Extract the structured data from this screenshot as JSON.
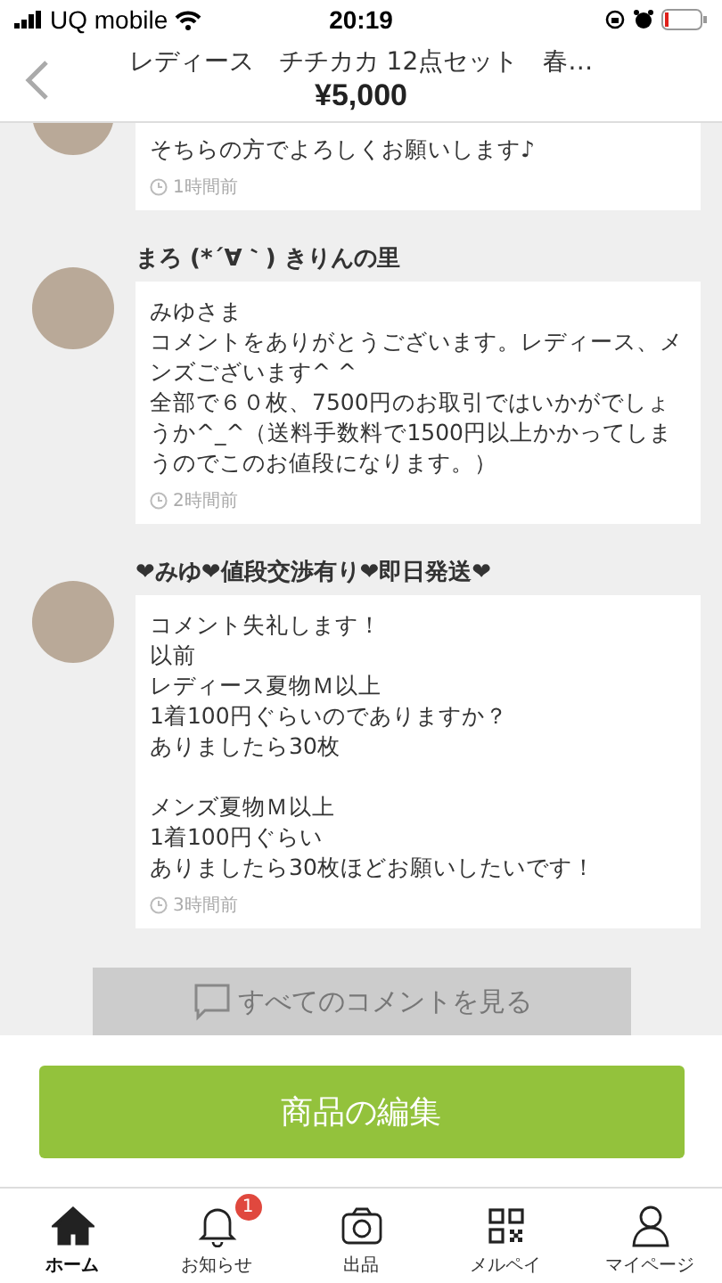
{
  "status_bar": {
    "carrier": "UQ mobile",
    "time": "20:19"
  },
  "header": {
    "title": "レディース　チチカカ 12点セット　春…",
    "price": "¥5,000"
  },
  "comments": [
    {
      "paragraphs": [
        [
          "そちらの方でよろしくお願いします♪"
        ]
      ],
      "time": "1時間前"
    },
    {
      "name": "まろ (*´∀｀) きりんの里",
      "paragraphs": [
        [
          "みゆさま",
          "コメントをありがとうございます。レディース、メンズございます^ ^",
          "全部で６０枚、7500円のお取引ではいかがでしょうか^_^（送料手数料で1500円以上かかってしまうのでこのお値段になります。）"
        ]
      ],
      "time": "2時間前"
    },
    {
      "name": "❤みゆ❤値段交渉有り❤即日発送❤",
      "paragraphs": [
        [
          "コメント失礼します！",
          "以前",
          "レディース夏物Ｍ以上",
          "1着100円ぐらいのでありますか？",
          "ありましたら30枚"
        ],
        [
          "メンズ夏物Ｍ以上",
          "1着100円ぐらい",
          "ありましたら30枚ほどお願いしたいです！"
        ]
      ],
      "time": "3時間前"
    }
  ],
  "all_comments_button": "すべてのコメントを見る",
  "edit_button": "商品の編集",
  "tabbar": [
    {
      "kind": "home",
      "label": "ホーム",
      "selected": true
    },
    {
      "kind": "bell",
      "label": "お知らせ",
      "selected": false,
      "badge": "1"
    },
    {
      "kind": "camera",
      "label": "出品",
      "selected": false
    },
    {
      "kind": "qr",
      "label": "メルペイ",
      "selected": false
    },
    {
      "kind": "person",
      "label": "マイページ",
      "selected": false
    }
  ]
}
